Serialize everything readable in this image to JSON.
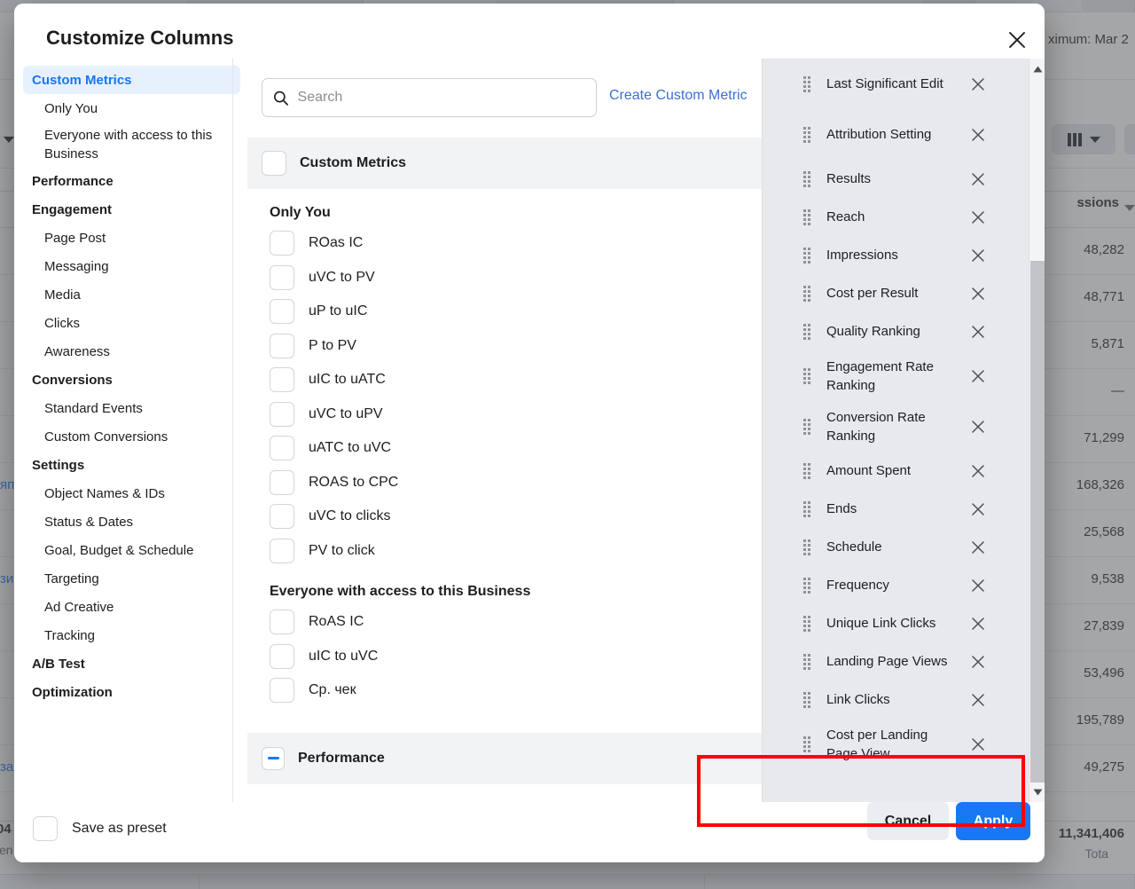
{
  "background": {
    "date_note": "ximum: Mar 2",
    "columns_button_icon": "columns-icon",
    "table_header": "ssions",
    "rows": [
      {
        "value": "48,282",
        "link": ""
      },
      {
        "value": "48,771",
        "link": ""
      },
      {
        "value": "5,871",
        "link": ""
      },
      {
        "value": "—",
        "link": ""
      },
      {
        "value": "71,299",
        "link": ""
      },
      {
        "value": "168,326",
        "link": "яп"
      },
      {
        "value": "25,568",
        "link": ""
      },
      {
        "value": "9,538",
        "link": "зи"
      },
      {
        "value": "27,839",
        "link": ""
      },
      {
        "value": "53,496",
        "link": ""
      },
      {
        "value": "195,789",
        "link": ""
      },
      {
        "value": "49,275",
        "link": "за"
      }
    ],
    "total_value": "11,341,406",
    "total_label": "Tota",
    "total_left_value": "04",
    "total_left_label": "cen"
  },
  "modal": {
    "title": "Customize Columns",
    "close_icon": "close-icon"
  },
  "nav": {
    "items": [
      {
        "label": "Custom Metrics",
        "type": "active"
      },
      {
        "label": "Only You",
        "type": "sub"
      },
      {
        "label": "Everyone with access to this Business",
        "type": "sub-wrap"
      },
      {
        "label": "Performance",
        "type": "group"
      },
      {
        "label": "Engagement",
        "type": "group"
      },
      {
        "label": "Page Post",
        "type": "sub"
      },
      {
        "label": "Messaging",
        "type": "sub"
      },
      {
        "label": "Media",
        "type": "sub"
      },
      {
        "label": "Clicks",
        "type": "sub"
      },
      {
        "label": "Awareness",
        "type": "sub"
      },
      {
        "label": "Conversions",
        "type": "group"
      },
      {
        "label": "Standard Events",
        "type": "sub"
      },
      {
        "label": "Custom Conversions",
        "type": "sub"
      },
      {
        "label": "Settings",
        "type": "group"
      },
      {
        "label": "Object Names & IDs",
        "type": "sub"
      },
      {
        "label": "Status & Dates",
        "type": "sub"
      },
      {
        "label": "Goal, Budget & Schedule",
        "type": "sub"
      },
      {
        "label": "Targeting",
        "type": "sub"
      },
      {
        "label": "Ad Creative",
        "type": "sub"
      },
      {
        "label": "Tracking",
        "type": "sub"
      },
      {
        "label": "A/B Test",
        "type": "group"
      },
      {
        "label": "Optimization",
        "type": "group"
      }
    ]
  },
  "search": {
    "placeholder": "Search",
    "value": "",
    "icon": "search-icon"
  },
  "create_custom_metric": {
    "label": "Create Custom Metric"
  },
  "middle": {
    "group_header": {
      "label": "Custom Metrics",
      "checked": false
    },
    "sections": [
      {
        "heading": "Only You",
        "options": [
          {
            "label": "ROas IC",
            "checked": false
          },
          {
            "label": "uVC to PV",
            "checked": false
          },
          {
            "label": "uP to uIC",
            "checked": false
          },
          {
            "label": "P to PV",
            "checked": false
          },
          {
            "label": "uIC to uATC",
            "checked": false
          },
          {
            "label": "uVC to uPV",
            "checked": false
          },
          {
            "label": "uATC to uVC",
            "checked": false
          },
          {
            "label": "ROAS to CPC",
            "checked": false
          },
          {
            "label": "uVC to clicks",
            "checked": false
          },
          {
            "label": "PV to click",
            "checked": false
          }
        ]
      },
      {
        "heading": "Everyone with access to this Business",
        "options": [
          {
            "label": "RoAS IC",
            "checked": false
          },
          {
            "label": "uIC to uVC",
            "checked": false
          },
          {
            "label": "Ср. чек",
            "checked": false
          }
        ]
      }
    ],
    "performance_group": {
      "label": "Performance",
      "state": "indeterminate"
    }
  },
  "selected_columns": {
    "drag_icon": "drag-handle-icon",
    "remove_icon": "close-icon",
    "items": [
      {
        "label": "Last Significant Edit"
      },
      {
        "label": "Attribution Setting"
      },
      {
        "label": "Results"
      },
      {
        "label": "Reach"
      },
      {
        "label": "Impressions"
      },
      {
        "label": "Cost per Result"
      },
      {
        "label": "Quality Ranking"
      },
      {
        "label": "Engagement Rate Ranking"
      },
      {
        "label": "Conversion Rate Ranking"
      },
      {
        "label": "Amount Spent"
      },
      {
        "label": "Ends"
      },
      {
        "label": "Schedule"
      },
      {
        "label": "Frequency"
      },
      {
        "label": "Unique Link Clicks"
      },
      {
        "label": "Landing Page Views"
      },
      {
        "label": "Link Clicks"
      },
      {
        "label": "Cost per Landing Page View"
      }
    ],
    "scroll_up_icon": "caret-up-icon",
    "scroll_down_icon": "caret-down-icon"
  },
  "footer": {
    "save_preset_label": "Save as preset",
    "save_preset_checked": false,
    "cancel_label": "Cancel",
    "apply_label": "Apply"
  },
  "annotation": {
    "type": "highlight-rectangle",
    "color": "#ff0000"
  }
}
